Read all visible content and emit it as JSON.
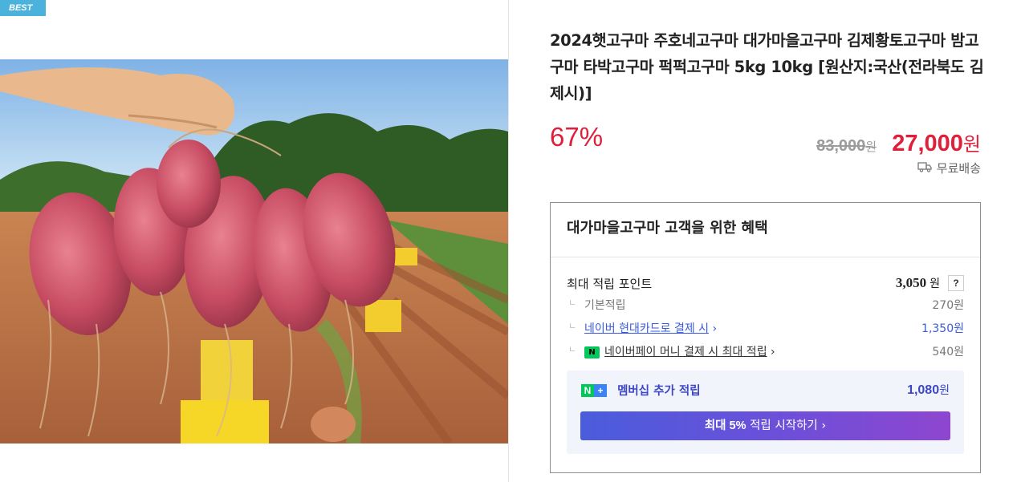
{
  "badge": "BEST",
  "product": {
    "title": "2024햇고구마 주호네고구마 대가마을고구마 김제황토고구마 밤고구마 타박고구마 퍽퍽고구마 5kg 10kg [원산지:국산(전라북도 김제시)]",
    "discount": "67%",
    "original_price": "83,000",
    "original_unit": "원",
    "price": "27,000",
    "price_unit": "원",
    "shipping": "무료배송",
    "shipping_icon": "truck-icon"
  },
  "benefits": {
    "heading": "대가마을고구마 고객을 위한 혜택",
    "max_points_label": "최대 적립 포인트",
    "max_points_value": "3,050",
    "max_points_unit": "원",
    "help": "?",
    "basic_label": "기본적립",
    "basic_value": "270원",
    "card_label": "네이버 현대카드로 결제 시",
    "card_value": "1,350원",
    "npay_label": "네이버페이 머니 결제 시 최대 적립",
    "npay_value": "540원",
    "npay_logo": "N",
    "membership": {
      "label": "멤버십 추가 적립",
      "value": "1,080",
      "unit": "원",
      "logo_left": "N",
      "logo_right": "+",
      "cta_bold": "최대 5%",
      "cta_rest": "적립 시작하기",
      "colors": {
        "accent": "#3d47c6",
        "cta_start": "#4a5cdc",
        "cta_end": "#8e46cf",
        "n_green": "#03c75a",
        "plus_blue": "#3b82f6"
      }
    }
  },
  "colors": {
    "price_red": "#e0203a",
    "badge_blue": "#4bb2db"
  }
}
